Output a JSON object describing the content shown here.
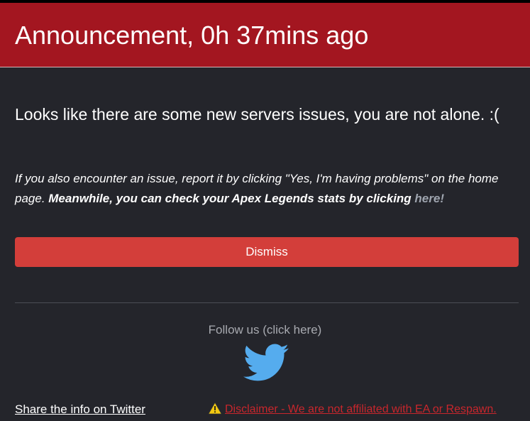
{
  "announcement": {
    "title": "Announcement, 0h 37mins ago",
    "headline": "Looks like there are some new servers issues, you are not alone. :(",
    "details_text": "If you also encounter an issue, report it by clicking \"Yes, I'm having problems\" on the home page. ",
    "details_bold": "Meanwhile, you can check your Apex Legends stats by clicking ",
    "details_link": "here!",
    "dismiss_label": "Dismiss"
  },
  "social": {
    "follow_label": "Follow us (click here)",
    "twitter_icon": "twitter-bird-icon",
    "twitter_color": "#55acee"
  },
  "footer": {
    "share_label": "Share the info on Twitter",
    "warning_icon": "warning-triangle-icon",
    "disclaimer_label": "Disclaimer - We are not affiliated with EA or Respawn."
  },
  "colors": {
    "header": "#a31620",
    "body": "#24252b",
    "button": "#d33e3a",
    "disclaimer": "#c8262c",
    "link_muted": "#9ea4ae"
  }
}
